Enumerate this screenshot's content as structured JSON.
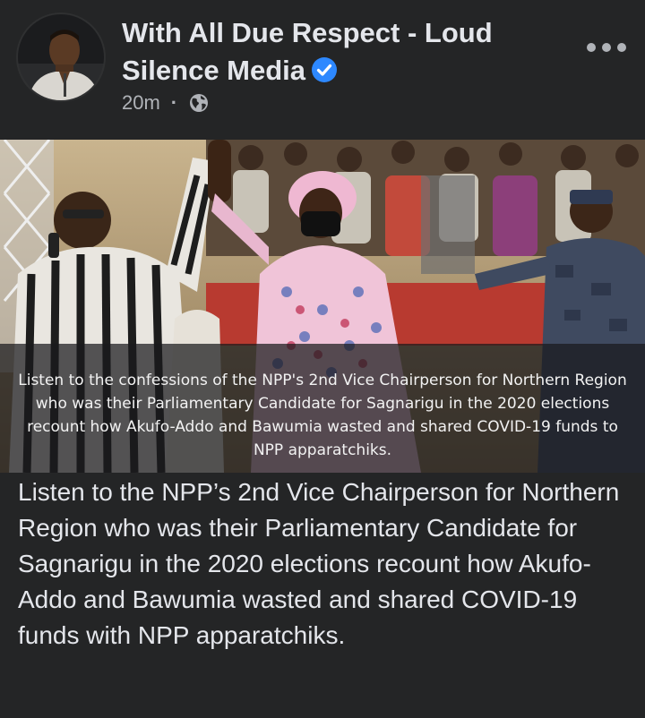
{
  "post": {
    "page_name": "With All Due Respect - Loud Silence Media",
    "timestamp": "20m",
    "separator": "·",
    "privacy_icon": "globe-icon",
    "verified_icon": "verified-badge-icon",
    "more_icon": "more-options-icon",
    "image_caption": "Listen to the confessions of the NPP's 2nd Vice Chairperson for Northern Region who was their Parliamentary Candidate for Sagnarigu in the 2020 elections recount how Akufo-Addo and Bawumia wasted and shared COVID-19 funds to NPP apparatchiks.",
    "text": "Listen to the NPP’s 2nd Vice Chairperson for Northern Region who was their Parliamentary Candidate for Sagnarigu in the 2020 elections recount how Akufo-Addo and Bawumia wasted and shared COVID-19 funds with NPP apparatchiks."
  },
  "colors": {
    "background": "#242526",
    "primary_text": "#e4e6eb",
    "secondary_text": "#b0b3b8",
    "verified_blue": "#2d88ff"
  }
}
